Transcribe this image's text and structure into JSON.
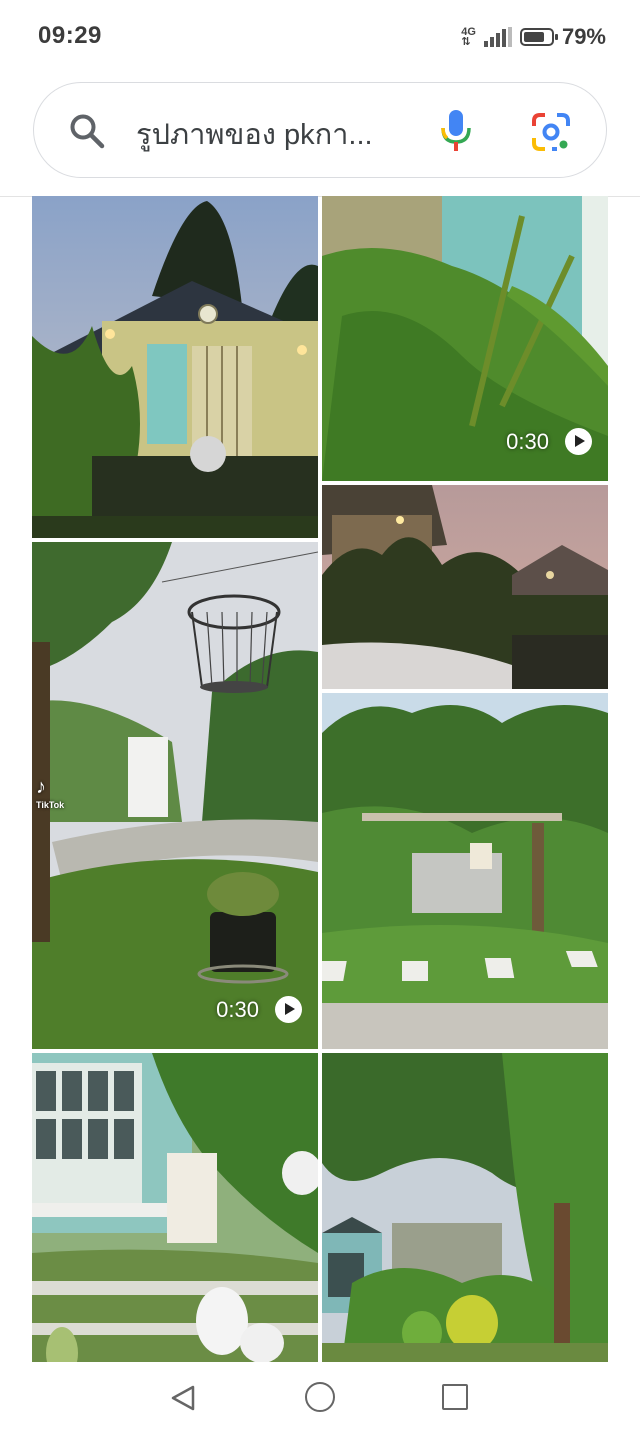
{
  "status": {
    "time": "09:29",
    "network": "4G",
    "battery_percent": "79%",
    "battery_level": 0.79
  },
  "search": {
    "query": "รูปภาพของ pkกา...",
    "icon_left": "search-icon",
    "icon_mic": "microphone-icon",
    "icon_lens": "google-lens-icon"
  },
  "results": [
    {
      "id": "house-dusk",
      "video": false
    },
    {
      "id": "green-plants",
      "video": true,
      "duration": "0:30"
    },
    {
      "id": "evening-garden",
      "video": false
    },
    {
      "id": "bird-cage-garden",
      "video": true,
      "duration": "0:30",
      "watermark": "TikTok"
    },
    {
      "id": "arch-garden-path",
      "video": false
    },
    {
      "id": "house-window-flowers",
      "video": false
    },
    {
      "id": "tree-canopy-garden",
      "video": false
    }
  ],
  "nav": {
    "back": "back-triangle-icon",
    "home": "home-circle-icon",
    "recent": "recent-apps-square-icon"
  },
  "colors": {
    "search_border": "#dadce0",
    "mic_blue": "#4285f4",
    "nav_gray": "#666666"
  }
}
